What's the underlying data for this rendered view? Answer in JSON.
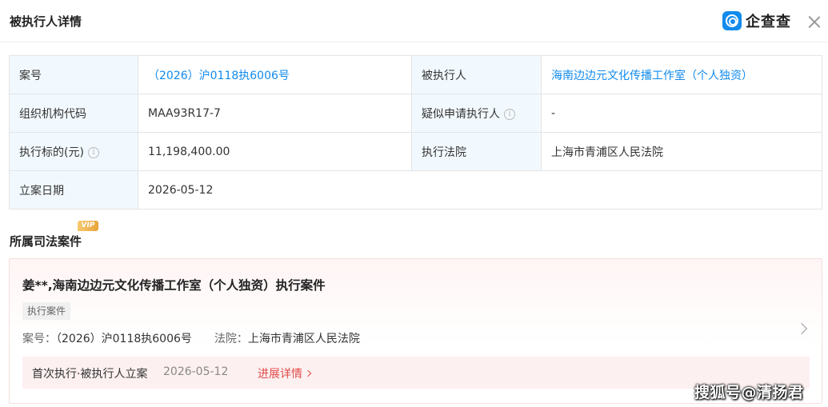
{
  "header": {
    "title": "被执行人详情",
    "brand_name": "企查查",
    "brand_color": "#128bed"
  },
  "info_table": {
    "rows": [
      [
        {
          "label": "案号",
          "value": "（2026）沪0118执6006号",
          "link": true
        },
        {
          "label": "被执行人",
          "value": "海南边边元文化传播工作室（个人独资）",
          "link": true
        }
      ],
      [
        {
          "label": "组织机构代码",
          "value": "MAA93R17-7"
        },
        {
          "label": "疑似申请执行人",
          "value": "-",
          "has_info_icon": true
        }
      ],
      [
        {
          "label": "执行标的(元)",
          "value": "11,198,400.00",
          "has_info_icon": true
        },
        {
          "label": "执行法院",
          "value": "上海市青浦区人民法院"
        }
      ],
      [
        {
          "label": "立案日期",
          "value": "2026-05-12"
        }
      ]
    ]
  },
  "related_cases": {
    "section_title": "所属司法案件",
    "vip_label": "VIP",
    "case": {
      "title": "姜**,海南边边元文化传播工作室（个人独资）执行案件",
      "tag": "执行案件",
      "case_no_label": "案号：",
      "case_no": "（2026）沪0118执6006号",
      "court_label": "法院：",
      "court": "上海市青浦区人民法院",
      "progress_event": "首次执行·被执行人立案",
      "progress_date": "2026-05-12",
      "progress_link": "进展详情"
    }
  },
  "watermark": "搜狐号@清扬君"
}
